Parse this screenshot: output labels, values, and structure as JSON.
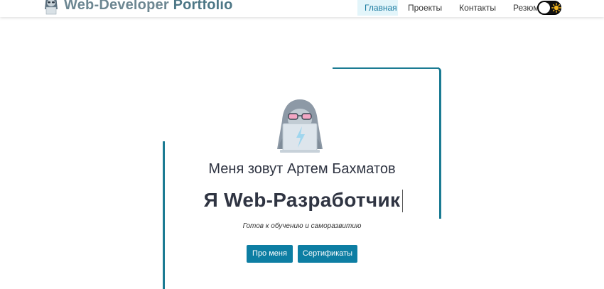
{
  "header": {
    "logo_main": "Web-Developer",
    "logo_accent": "Portfolio",
    "logo_icon": "hacker-icon",
    "nav": [
      {
        "label": "Главная",
        "active": true
      },
      {
        "label": "Проекты",
        "active": false
      },
      {
        "label": "Контакты",
        "active": false
      },
      {
        "label": "Резюме",
        "active": false
      }
    ],
    "theme_toggle": {
      "icon": "sun-icon",
      "state": "light"
    }
  },
  "hero": {
    "avatar_icon": "hacker-laptop-icon",
    "name_line": "Меня зовут Артем Бахматов",
    "role_line": "Я Web-Разработчик",
    "tagline": "Готов к обучению и саморазвитию",
    "buttons": {
      "about": "Про меня",
      "certificates": "Сертификаты"
    }
  },
  "colors": {
    "accent": "#0d7ea3",
    "frame": "#1b7b93",
    "active_nav_bg": "#e3f5fa"
  }
}
